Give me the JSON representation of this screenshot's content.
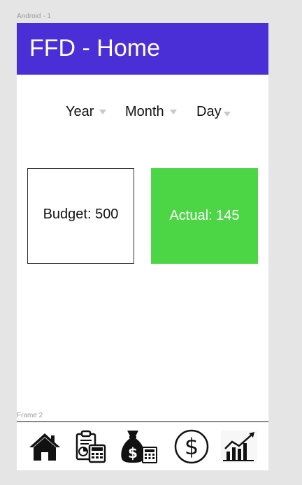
{
  "labels": {
    "artboard": "Android - 1",
    "frame": "Frame 2"
  },
  "appbar": {
    "title": "FFD - Home",
    "color": "#4a2fd6"
  },
  "filters": {
    "year_label": "Year",
    "month_label": "Month",
    "day_label": "Day"
  },
  "cards": {
    "budget_text": "Budget: 500",
    "actual_text": "Actual: 145",
    "actual_color": "#4cd645"
  },
  "bottom_nav": {
    "items": [
      {
        "icon": "home-icon"
      },
      {
        "icon": "report-clipboard-calculator-icon"
      },
      {
        "icon": "money-bag-calculator-icon"
      },
      {
        "icon": "dollar-circle-icon"
      },
      {
        "icon": "growth-chart-icon"
      }
    ]
  }
}
